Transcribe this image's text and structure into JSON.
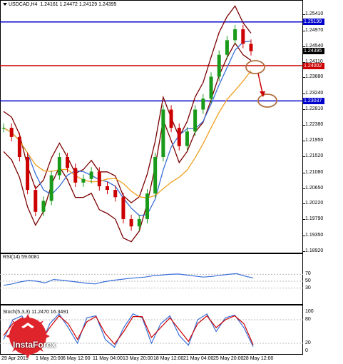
{
  "header": {
    "symbol": "USDCAD,H4",
    "ohlc": "1.24161 1.24472 1.24129 1.24395"
  },
  "price_axis": {
    "ticks": [
      "1.25410",
      "1.24970",
      "1.24540",
      "1.24110",
      "1.23680",
      "1.23240",
      "1.22810",
      "1.22380",
      "1.21950",
      "1.21520",
      "1.21080",
      "1.20650",
      "1.20220",
      "1.19790",
      "1.19350",
      "1.18920"
    ],
    "tags": [
      {
        "label": "1.25199",
        "color": "#0000cc"
      },
      {
        "label": "1.24395",
        "color": "#000000"
      },
      {
        "label": "1.24002",
        "color": "#cc0000"
      },
      {
        "label": "1.23037",
        "color": "#0000cc"
      }
    ]
  },
  "rsi": {
    "label": "RSI(14) 59.6081",
    "ticks": [
      "70",
      "50",
      "30"
    ]
  },
  "stoch": {
    "label": "Stoch(5,3,3) 11.2470 16.3491",
    "ticks": [
      "100",
      "80",
      "20",
      "0"
    ]
  },
  "time_axis": [
    "29 Apr 2015",
    "1 May 20:00",
    "6 May 12:00",
    "11 May 04:00",
    "13 May 20:00",
    "18 May 12:00",
    "21 May 04:00",
    "25 May 20:00",
    "28 May 12:00"
  ],
  "watermark": "InstaForex",
  "colors": {
    "resistance": "#0000cc",
    "support": "#cc0000",
    "bollinger": "#7b0000",
    "ma_fast": "#3a6fd8",
    "ma_slow": "#f0a020",
    "forecast": "#cc0000",
    "circle": "#b07040"
  },
  "chart_data": [
    {
      "type": "line",
      "title": "USDCAD,H4",
      "ylim": [
        1.1892,
        1.256
      ],
      "horizontal_levels": [
        1.25199,
        1.24002,
        1.23037
      ],
      "last_price": 1.24395,
      "series": [
        {
          "name": "",
          "values": [
            1.223,
            1.2205,
            1.215,
            1.206,
            1.2,
            1.203,
            1.21,
            1.215,
            1.212,
            1.208,
            1.209,
            1.211,
            1.207,
            1.206,
            1.204,
            1.198,
            1.196,
            1.198,
            1.205,
            1.215,
            1.228,
            1.223,
            1.218,
            1.222,
            1.228,
            1.231,
            1.237,
            1.243,
            1.247,
            1.25,
            1.246,
            1.244
          ]
        }
      ]
    },
    {
      "type": "line",
      "title": "RSI(14) 59.6081",
      "ylim": [
        0,
        100
      ],
      "series": [
        {
          "name": "",
          "values": [
            38,
            42,
            48,
            52,
            50,
            45,
            55,
            53,
            50,
            47,
            44,
            42,
            48,
            52,
            55,
            58,
            60,
            62,
            66,
            68,
            70,
            71,
            68,
            65,
            62,
            64,
            67,
            70,
            72,
            65,
            59.6
          ]
        }
      ]
    },
    {
      "type": "line",
      "title": "Stoch(5,3,3) 11.2470 16.3491",
      "ylim": [
        0,
        100
      ],
      "series": [
        {
          "name": "",
          "values": [
            30,
            80,
            90,
            40,
            15,
            70,
            95,
            60,
            20,
            85,
            90,
            30,
            10,
            60,
            95,
            85,
            20,
            70,
            90,
            40,
            15,
            80,
            95,
            50,
            85,
            92,
            60,
            11.2
          ]
        },
        {
          "name": "",
          "values": [
            40,
            70,
            85,
            55,
            25,
            60,
            90,
            70,
            30,
            75,
            88,
            45,
            18,
            50,
            88,
            88,
            35,
            60,
            85,
            55,
            25,
            70,
            90,
            60,
            80,
            90,
            70,
            16.3
          ]
        }
      ]
    }
  ]
}
